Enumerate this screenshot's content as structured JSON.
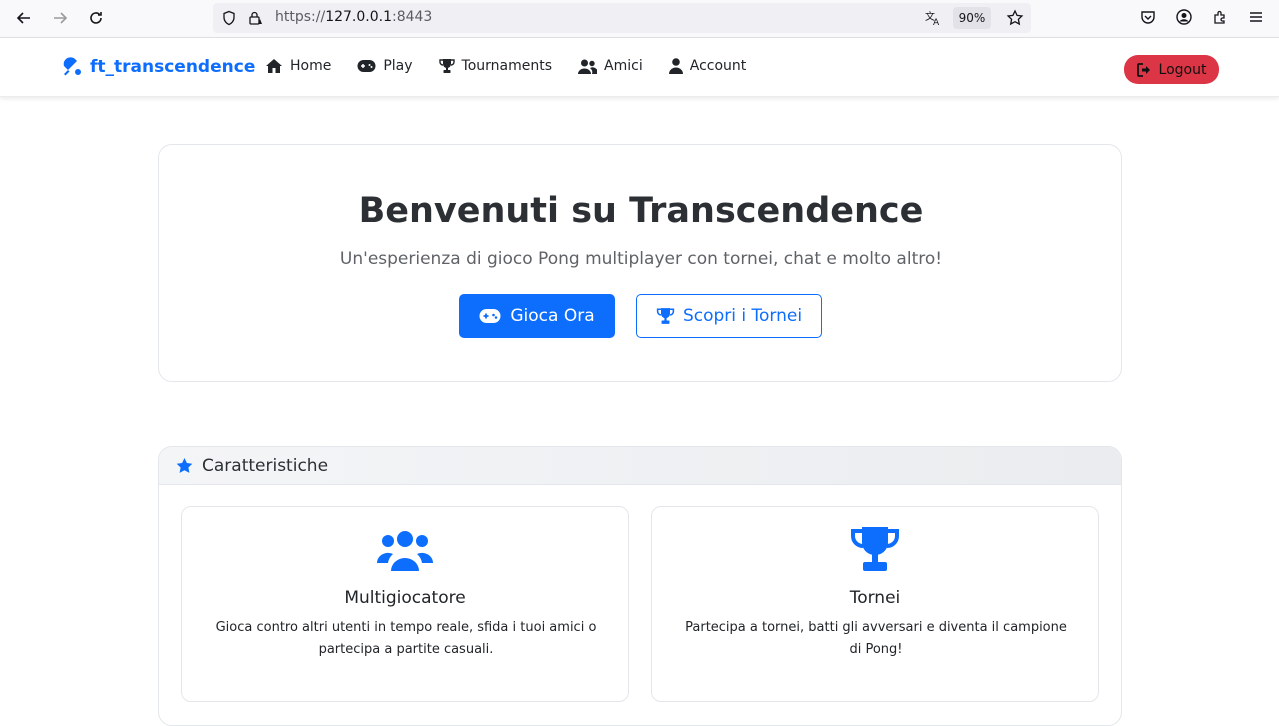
{
  "browser": {
    "url_scheme": "https://",
    "url_host": "127.0.0.1",
    "url_port": ":8443",
    "zoom": "90%"
  },
  "navbar": {
    "brand": "ft_transcendence",
    "links": [
      {
        "label": "Home",
        "icon": "home-icon"
      },
      {
        "label": "Play",
        "icon": "gamepad-icon"
      },
      {
        "label": "Tournaments",
        "icon": "trophy-icon"
      },
      {
        "label": "Amici",
        "icon": "users-icon"
      },
      {
        "label": "Account",
        "icon": "user-icon"
      }
    ],
    "logout_label": "Logout"
  },
  "hero": {
    "title": "Benvenuti su Transcendence",
    "subtitle": "Un'esperienza di gioco Pong multiplayer con tornei, chat e molto altro!",
    "primary_button": "Gioca Ora",
    "secondary_button": "Scopri i Tornei"
  },
  "features": {
    "header": "Caratteristiche",
    "items": [
      {
        "title": "Multigiocatore",
        "description": "Gioca contro altri utenti in tempo reale, sfida i tuoi amici o partecipa a partite casuali.",
        "icon": "users-icon"
      },
      {
        "title": "Tornei",
        "description": "Partecipa a tornei, batti gli avversari e diventa il campione di Pong!",
        "icon": "trophy-icon"
      }
    ]
  },
  "colors": {
    "primary": "#0d6efd",
    "danger": "#dc3545"
  }
}
